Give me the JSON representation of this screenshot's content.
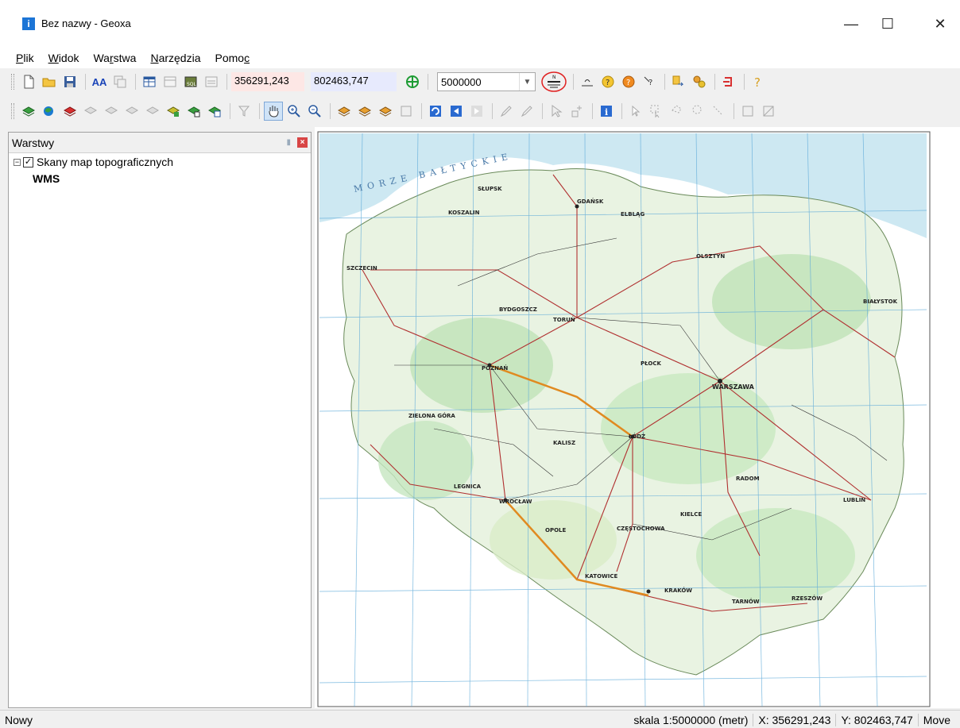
{
  "window": {
    "title": "Bez nazwy - Geoxa",
    "icon": "info-app-icon",
    "controls": {
      "minimize": "—",
      "maximize": "☐",
      "close": "✕"
    }
  },
  "menu": {
    "items": [
      {
        "label": "Plik",
        "key": "P",
        "rest": "lik"
      },
      {
        "label": "Widok",
        "key": "W",
        "rest": "idok"
      },
      {
        "label": "Warstwa",
        "pre": "Wa",
        "key": "r",
        "rest": "stwa"
      },
      {
        "label": "Narzędzia",
        "key": "N",
        "rest": "arzędzia"
      },
      {
        "label": "Pomoc",
        "pre": "Pomo",
        "key": "c",
        "rest": ""
      }
    ]
  },
  "toolbar": {
    "coord_x": "356291,243",
    "coord_y": "802463,747",
    "scale": "5000000",
    "aa_label": "AA",
    "annotation_color": "#e02020"
  },
  "layers": {
    "title": "Warstwy",
    "items": [
      {
        "label": "Skany map topograficznych",
        "checked": true,
        "expanded": true
      }
    ],
    "sub_label": "WMS"
  },
  "map": {
    "sea_label": "MORZE  BAŁTYCKIE",
    "cities": {
      "warszawa": "WARSZAWA",
      "poznan": "POZNAŃ",
      "wroclaw": "WROCŁAW",
      "krakow": "KRAKÓW",
      "lodz": "ŁÓDŹ",
      "gdansk": "GDAŃSK",
      "bialystok": "BIAŁYSTOK",
      "lublin": "LUBLIN",
      "szczecin": "SZCZECIN",
      "katowice": "KATOWICE",
      "bydgoszcz": "BYDGOSZCZ",
      "torun": "TORUŃ",
      "kielce": "KIELCE",
      "rzeszow": "RZESZÓW",
      "olsztyn": "OLSZTYN",
      "radom": "RADOM",
      "czestochowa": "CZĘSTOCHOWA",
      "opole": "OPOLE",
      "zielona_gora": "ZIELONA GÓRA",
      "koszalin": "KOSZALIN",
      "slupsk": "SŁUPSK",
      "elblag": "ELBLĄG",
      "plock": "PŁOCK",
      "kalisz": "KALISZ",
      "legnica": "LEGNICA",
      "tarnow": "TARNÓW"
    }
  },
  "status": {
    "left": "Nowy",
    "scale": "skala 1:5000000 (metr)",
    "x": "X: 356291,243",
    "y": "Y: 802463,747",
    "mode": "Move"
  }
}
